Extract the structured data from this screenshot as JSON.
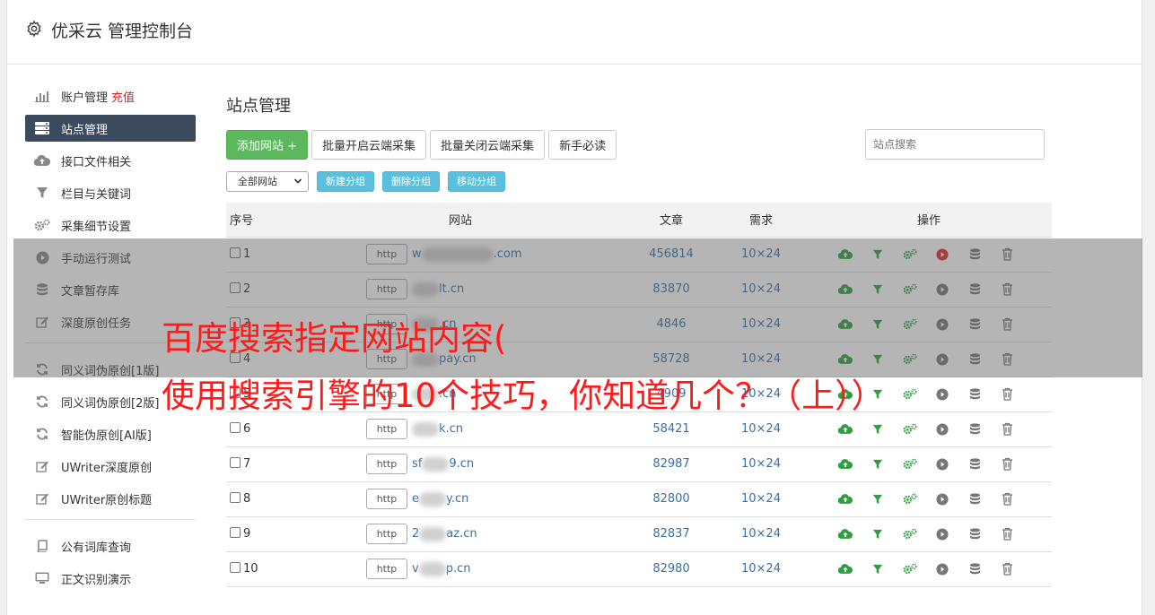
{
  "header": {
    "title": "优采云 管理控制台",
    "icon": "gear-icon"
  },
  "sidebar": {
    "items": [
      {
        "label": "账户管理",
        "badge": "充值",
        "icon": "bar-chart-icon"
      },
      {
        "label": "站点管理",
        "icon": "server-icon",
        "active": true
      },
      {
        "label": "接口文件相关",
        "icon": "cloud-upload-icon"
      },
      {
        "label": "栏目与关键词",
        "icon": "filter-icon"
      },
      {
        "label": "采集细节设置",
        "icon": "gears-icon"
      },
      {
        "label": "手动运行测试",
        "icon": "play-circle-icon"
      },
      {
        "label": "文章暂存库",
        "icon": "database-icon"
      },
      {
        "label": "深度原创任务",
        "icon": "edit-icon"
      },
      {
        "label": "同义词伪原创[1版]",
        "icon": "refresh-icon"
      },
      {
        "label": "同义词伪原创[2版]",
        "icon": "refresh-icon"
      },
      {
        "label": "智能伪原创[AI版]",
        "icon": "refresh-icon"
      },
      {
        "label": "UWriter深度原创",
        "icon": "edit-icon"
      },
      {
        "label": "UWriter原创标题",
        "icon": "edit-icon"
      },
      {
        "label": "公有词库查询",
        "icon": "book-icon"
      },
      {
        "label": "正文识别演示",
        "icon": "monitor-icon"
      }
    ]
  },
  "main": {
    "title": "站点管理",
    "toolbar": {
      "add_site": "添加网站 +",
      "batch_open": "批量开启云端采集",
      "batch_close": "批量关闭云端采集",
      "guide": "新手必读",
      "search_placeholder": "站点搜索"
    },
    "toolbar2": {
      "group_select": "全部网站",
      "new_group": "新建分组",
      "delete_group": "删除分组",
      "move_group": "移动分组"
    },
    "table": {
      "headers": {
        "no": "序号",
        "site": "网站",
        "articles": "文章",
        "demand": "需求",
        "ops": "操作"
      },
      "rows": [
        {
          "no": "1",
          "proto": "http",
          "prefix": "w",
          "suffix": ".com",
          "articles": "456814",
          "demand": "10×24"
        },
        {
          "no": "2",
          "proto": "http",
          "prefix": "",
          "suffix": "lt.cn",
          "articles": "83870",
          "demand": "10×24"
        },
        {
          "no": "3",
          "proto": "http",
          "prefix": "",
          "suffix": ".cn",
          "articles": "4846",
          "demand": "10×24"
        },
        {
          "no": "4",
          "proto": "http",
          "prefix": "",
          "suffix": "pay.cn",
          "articles": "58728",
          "demand": "10×24"
        },
        {
          "no": "5",
          "proto": "http",
          "prefix": "",
          "suffix": ".cn",
          "articles": "4909",
          "demand": "10×24"
        },
        {
          "no": "6",
          "proto": "http",
          "prefix": "",
          "suffix": "k.cn",
          "articles": "58421",
          "demand": "10×24"
        },
        {
          "no": "7",
          "proto": "http",
          "prefix": "sf",
          "suffix": "9.cn",
          "articles": "82987",
          "demand": "10×24"
        },
        {
          "no": "8",
          "proto": "http",
          "prefix": "e",
          "suffix": "y.cn",
          "articles": "82800",
          "demand": "10×24"
        },
        {
          "no": "9",
          "proto": "http",
          "prefix": "2",
          "suffix": "az.cn",
          "articles": "82837",
          "demand": "10×24"
        },
        {
          "no": "10",
          "proto": "http",
          "prefix": "v",
          "suffix": "p.cn",
          "articles": "82980",
          "demand": "10×24"
        }
      ]
    }
  },
  "overlay": {
    "line1": "百度搜索指定网站内容(",
    "line2": "使用搜索引擎的10个技巧，你知道几个？（上））"
  },
  "colors": {
    "accent_green": "#5cb85c",
    "info_blue": "#5bc0de",
    "sidebar_active": "#3c4a5d",
    "headline_red": "#ff1a1a",
    "link_blue": "#3a6fa0"
  }
}
